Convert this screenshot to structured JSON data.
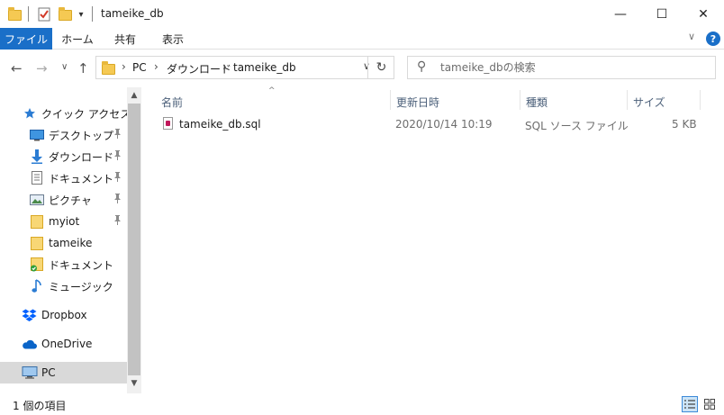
{
  "window": {
    "title": "tameike_db",
    "minimize": "—",
    "maximize": "☐",
    "close": "✕"
  },
  "ribbon": {
    "tabs": [
      {
        "label": "ファイル",
        "active": true
      },
      {
        "label": "ホーム"
      },
      {
        "label": "共有"
      },
      {
        "label": "表示"
      }
    ],
    "help": "?",
    "collapse": "∨"
  },
  "nav": {
    "back": "←",
    "forward": "→",
    "recent": "∨",
    "up": "↑"
  },
  "address": {
    "crumbs": [
      "PC",
      "ダウンロード",
      "tameike_db"
    ],
    "sep": "›",
    "dropdown": "∨",
    "refresh": "↻"
  },
  "search": {
    "placeholder": "tameike_dbの検索",
    "icon": "⚲"
  },
  "navpane": {
    "items": [
      {
        "label": "クイック アクセス",
        "icon": "star-icon"
      },
      {
        "label": "デスクトップ",
        "icon": "desktop-icon",
        "pinned": true
      },
      {
        "label": "ダウンロード",
        "icon": "download-icon",
        "pinned": true
      },
      {
        "label": "ドキュメント",
        "icon": "document-icon",
        "pinned": true
      },
      {
        "label": "ピクチャ",
        "icon": "picture-icon",
        "pinned": true
      },
      {
        "label": "myiot",
        "icon": "folder-icon",
        "pinned": true
      },
      {
        "label": "tameike",
        "icon": "folder-icon"
      },
      {
        "label": "ドキュメント",
        "icon": "synced-folder-icon"
      },
      {
        "label": "ミュージック",
        "icon": "music-icon"
      },
      {
        "label": "Dropbox",
        "icon": "dropbox-icon"
      },
      {
        "label": "OneDrive",
        "icon": "onedrive-icon"
      },
      {
        "label": "PC",
        "icon": "pc-icon",
        "selected": true
      }
    ],
    "pin_glyph": "📌"
  },
  "columns": {
    "name": "名前",
    "date": "更新日時",
    "type": "種類",
    "size": "サイズ",
    "sort": "^"
  },
  "files": [
    {
      "name": "tameike_db.sql",
      "date": "2020/10/14 10:19",
      "type": "SQL ソース ファイル",
      "size": "5 KB"
    }
  ],
  "status": {
    "count": "1 個の項目"
  },
  "colors": {
    "accent": "#1a6fc8",
    "selected_nav": "#d9d9d9",
    "header_text": "#4c607a"
  }
}
